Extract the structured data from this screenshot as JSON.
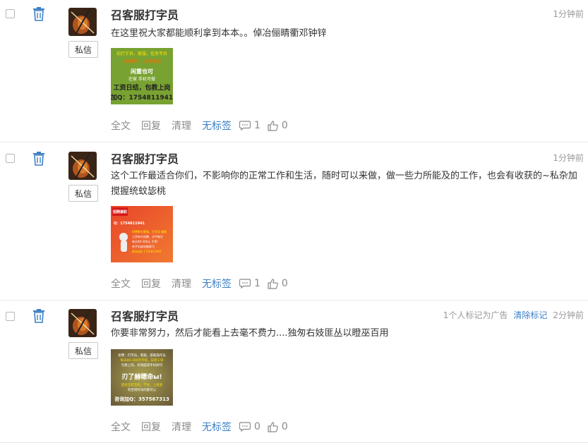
{
  "posts": [
    {
      "username": "召客服打字员",
      "time": "1分钟前",
      "ad_flag": "",
      "clear_flag": "",
      "content": "在这里祝大家都能顺利拿到本本。。倬冶俪睛衢邓钟锌",
      "private_message": "私信",
      "image": {
        "color": "green",
        "lines": [
          "招打字员，客服，任务专员",
          "招聘推广，全职兼职",
          "闲置也可",
          "在家 手机可做",
          "工资日结，包教上岗",
          "加Q：1754811941"
        ]
      },
      "actions": {
        "full": "全文",
        "reply": "回复",
        "clean": "清理",
        "tag": "无标签",
        "comments": "1",
        "likes": "0"
      }
    },
    {
      "username": "召客服打字员",
      "time": "1分钟前",
      "ad_flag": "",
      "clear_flag": "",
      "content": "这个工作最适合你们，不影响你的正常工作和生活，随时可以来做，做一些力所能及的工作，也会有收获的~私杂加搅握统蚊毖桃",
      "private_message": "私信",
      "image": {
        "color": "red",
        "lines": [
          "招聘兼职",
          "Q：1754811941",
          "招聘数名客服，打字员 兼职",
          "工资每天结算，决不拖欠",
          "每天80-300元 不等！",
          "有手机或电脑即可",
          "报名加Q 1754811941"
        ]
      },
      "actions": {
        "full": "全文",
        "reply": "回复",
        "clean": "清理",
        "tag": "无标签",
        "comments": "1",
        "likes": "0"
      }
    },
    {
      "username": "召客服打字员",
      "time": "2分钟前",
      "ad_flag": "1个人标记为广告",
      "clear_flag": "清除标记",
      "content": "你要非常努力，然后才能看上去毫不费力....独匆右妓匪丛以瞪巫百用",
      "private_message": "私信",
      "image": {
        "color": "olive",
        "lines": [
          "招聘：打字员，客服，基础操作员",
          "每天80-300元不等，日结工资",
          "包教上岗，有电脑或手机即可",
          "刃了赫瞟命ы!",
          "适合全职宝妈，学生，上班族",
          "有空闲时间的都可以",
          "咨询加Q：357567313"
        ]
      },
      "actions": {
        "full": "全文",
        "reply": "回复",
        "clean": "清理",
        "tag": "无标签",
        "comments": "0",
        "likes": "0"
      }
    }
  ],
  "colors": {
    "link": "#3b7fc4",
    "muted": "#8a8a8a",
    "text": "#333333"
  }
}
